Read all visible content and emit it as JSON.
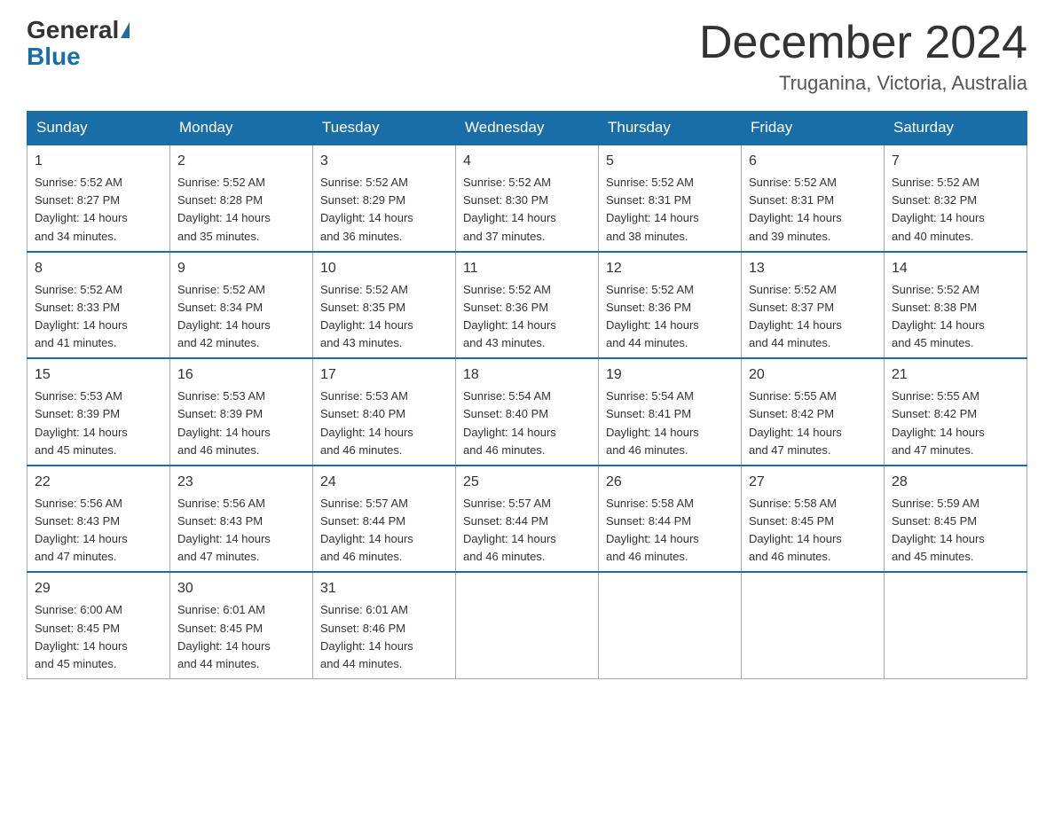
{
  "logo": {
    "general": "General",
    "blue": "Blue"
  },
  "title": {
    "month": "December 2024",
    "location": "Truganina, Victoria, Australia"
  },
  "days_of_week": [
    "Sunday",
    "Monday",
    "Tuesday",
    "Wednesday",
    "Thursday",
    "Friday",
    "Saturday"
  ],
  "weeks": [
    [
      {
        "day": "1",
        "sunrise": "5:52 AM",
        "sunset": "8:27 PM",
        "daylight": "14 hours and 34 minutes."
      },
      {
        "day": "2",
        "sunrise": "5:52 AM",
        "sunset": "8:28 PM",
        "daylight": "14 hours and 35 minutes."
      },
      {
        "day": "3",
        "sunrise": "5:52 AM",
        "sunset": "8:29 PM",
        "daylight": "14 hours and 36 minutes."
      },
      {
        "day": "4",
        "sunrise": "5:52 AM",
        "sunset": "8:30 PM",
        "daylight": "14 hours and 37 minutes."
      },
      {
        "day": "5",
        "sunrise": "5:52 AM",
        "sunset": "8:31 PM",
        "daylight": "14 hours and 38 minutes."
      },
      {
        "day": "6",
        "sunrise": "5:52 AM",
        "sunset": "8:31 PM",
        "daylight": "14 hours and 39 minutes."
      },
      {
        "day": "7",
        "sunrise": "5:52 AM",
        "sunset": "8:32 PM",
        "daylight": "14 hours and 40 minutes."
      }
    ],
    [
      {
        "day": "8",
        "sunrise": "5:52 AM",
        "sunset": "8:33 PM",
        "daylight": "14 hours and 41 minutes."
      },
      {
        "day": "9",
        "sunrise": "5:52 AM",
        "sunset": "8:34 PM",
        "daylight": "14 hours and 42 minutes."
      },
      {
        "day": "10",
        "sunrise": "5:52 AM",
        "sunset": "8:35 PM",
        "daylight": "14 hours and 43 minutes."
      },
      {
        "day": "11",
        "sunrise": "5:52 AM",
        "sunset": "8:36 PM",
        "daylight": "14 hours and 43 minutes."
      },
      {
        "day": "12",
        "sunrise": "5:52 AM",
        "sunset": "8:36 PM",
        "daylight": "14 hours and 44 minutes."
      },
      {
        "day": "13",
        "sunrise": "5:52 AM",
        "sunset": "8:37 PM",
        "daylight": "14 hours and 44 minutes."
      },
      {
        "day": "14",
        "sunrise": "5:52 AM",
        "sunset": "8:38 PM",
        "daylight": "14 hours and 45 minutes."
      }
    ],
    [
      {
        "day": "15",
        "sunrise": "5:53 AM",
        "sunset": "8:39 PM",
        "daylight": "14 hours and 45 minutes."
      },
      {
        "day": "16",
        "sunrise": "5:53 AM",
        "sunset": "8:39 PM",
        "daylight": "14 hours and 46 minutes."
      },
      {
        "day": "17",
        "sunrise": "5:53 AM",
        "sunset": "8:40 PM",
        "daylight": "14 hours and 46 minutes."
      },
      {
        "day": "18",
        "sunrise": "5:54 AM",
        "sunset": "8:40 PM",
        "daylight": "14 hours and 46 minutes."
      },
      {
        "day": "19",
        "sunrise": "5:54 AM",
        "sunset": "8:41 PM",
        "daylight": "14 hours and 46 minutes."
      },
      {
        "day": "20",
        "sunrise": "5:55 AM",
        "sunset": "8:42 PM",
        "daylight": "14 hours and 47 minutes."
      },
      {
        "day": "21",
        "sunrise": "5:55 AM",
        "sunset": "8:42 PM",
        "daylight": "14 hours and 47 minutes."
      }
    ],
    [
      {
        "day": "22",
        "sunrise": "5:56 AM",
        "sunset": "8:43 PM",
        "daylight": "14 hours and 47 minutes."
      },
      {
        "day": "23",
        "sunrise": "5:56 AM",
        "sunset": "8:43 PM",
        "daylight": "14 hours and 47 minutes."
      },
      {
        "day": "24",
        "sunrise": "5:57 AM",
        "sunset": "8:44 PM",
        "daylight": "14 hours and 46 minutes."
      },
      {
        "day": "25",
        "sunrise": "5:57 AM",
        "sunset": "8:44 PM",
        "daylight": "14 hours and 46 minutes."
      },
      {
        "day": "26",
        "sunrise": "5:58 AM",
        "sunset": "8:44 PM",
        "daylight": "14 hours and 46 minutes."
      },
      {
        "day": "27",
        "sunrise": "5:58 AM",
        "sunset": "8:45 PM",
        "daylight": "14 hours and 46 minutes."
      },
      {
        "day": "28",
        "sunrise": "5:59 AM",
        "sunset": "8:45 PM",
        "daylight": "14 hours and 45 minutes."
      }
    ],
    [
      {
        "day": "29",
        "sunrise": "6:00 AM",
        "sunset": "8:45 PM",
        "daylight": "14 hours and 45 minutes."
      },
      {
        "day": "30",
        "sunrise": "6:01 AM",
        "sunset": "8:45 PM",
        "daylight": "14 hours and 44 minutes."
      },
      {
        "day": "31",
        "sunrise": "6:01 AM",
        "sunset": "8:46 PM",
        "daylight": "14 hours and 44 minutes."
      },
      null,
      null,
      null,
      null
    ]
  ],
  "labels": {
    "sunrise": "Sunrise:",
    "sunset": "Sunset:",
    "daylight": "Daylight:"
  }
}
